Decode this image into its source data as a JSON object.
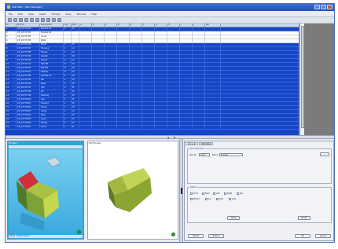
{
  "window": {
    "title": "CAD PRO - [Part Manager]",
    "controls": [
      "minimize",
      "maximize",
      "close"
    ]
  },
  "menu": [
    "File",
    "Edit",
    "View",
    "Insert",
    "Format",
    "Tools",
    "Window",
    "Help"
  ],
  "toolbar_icons": [
    "new-icon",
    "open-icon",
    "save-icon",
    "print-icon",
    "cut-icon",
    "copy-icon",
    "paste-icon",
    "undo-icon",
    "zoom-icon",
    "rotate-icon"
  ],
  "grid": {
    "columns": [
      "No",
      "Part ID",
      "Description",
      "Qty",
      "Mat",
      "A",
      "B",
      "C",
      "D",
      "E",
      "F",
      "G",
      "H",
      "I",
      "J",
      "Ref"
    ],
    "rows": [
      {
        "style": "blue",
        "cells": [
          "1",
          "UP_12371782",
          "Bracket 01",
          "1",
          "St",
          "",
          "",
          "",
          "",
          "",
          "",
          "",
          "",
          "",
          "",
          ""
        ]
      },
      {
        "style": "white",
        "cells": [
          "2",
          "UP_12371783",
          "Bracket 02",
          "",
          "",
          "",
          "",
          "",
          "",
          "",
          "",
          "",
          "",
          "",
          "",
          ""
        ]
      },
      {
        "style": "white",
        "cells": [
          "3",
          "UP_12371784",
          "Cover",
          "",
          "",
          "",
          "",
          "",
          "",
          "",
          "",
          "",
          "",
          "",
          "",
          ""
        ]
      },
      {
        "style": "white",
        "cells": [
          "4",
          "UP_12371785",
          "Plate",
          "",
          "",
          "",
          "",
          "",
          "",
          "",
          "",
          "",
          "",
          "",
          "",
          ""
        ]
      },
      {
        "style": "blue",
        "cells": [
          "5",
          "UP_12371786",
          "Shaft",
          "2",
          "St",
          "",
          "",
          "",
          "",
          "",
          "",
          "",
          "",
          "",
          "",
          ""
        ]
      },
      {
        "style": "blue",
        "cells": [
          "6",
          "UP_12371787",
          "Housing",
          "1",
          "Al",
          "",
          "",
          "",
          "",
          "",
          "",
          "",
          "",
          "",
          "",
          ""
        ]
      },
      {
        "style": "blue",
        "cells": [
          "7",
          "UP_12371788",
          "Flange",
          "1",
          "St",
          "",
          "",
          "",
          "",
          "",
          "",
          "",
          "",
          "",
          "",
          ""
        ]
      },
      {
        "style": "blue",
        "cells": [
          "8",
          "UP_12371789",
          "Gasket",
          "4",
          "Rb",
          "",
          "",
          "",
          "",
          "",
          "",
          "",
          "",
          "",
          "",
          ""
        ]
      },
      {
        "style": "blue",
        "cells": [
          "9",
          "UP_12371790",
          "Spacer",
          "2",
          "Al",
          "",
          "",
          "",
          "",
          "",
          "",
          "",
          "",
          "",
          "",
          ""
        ]
      },
      {
        "style": "blue",
        "cells": [
          "10",
          "UP_12371791",
          "Bolt M6",
          "8",
          "St",
          "",
          "",
          "",
          "",
          "",
          "",
          "",
          "",
          "",
          "",
          ""
        ]
      },
      {
        "style": "blue",
        "cells": [
          "11",
          "UP_12371792",
          "Nut M6",
          "8",
          "St",
          "",
          "",
          "",
          "",
          "",
          "",
          "",
          "",
          "",
          "",
          ""
        ]
      },
      {
        "style": "blue",
        "cells": [
          "12",
          "UP_12371793",
          "Washer",
          "8",
          "St",
          "",
          "",
          "",
          "",
          "",
          "",
          "",
          "",
          "",
          "",
          ""
        ]
      },
      {
        "style": "blue",
        "cells": [
          "13",
          "UP_12371794",
          "Bracket 03",
          "1",
          "St",
          "",
          "",
          "",
          "",
          "",
          "",
          "",
          "",
          "",
          "",
          ""
        ]
      },
      {
        "style": "blue",
        "cells": [
          "14",
          "UP_12371795",
          "Rib",
          "2",
          "St",
          "",
          "",
          "",
          "",
          "",
          "",
          "",
          "",
          "",
          "",
          ""
        ]
      },
      {
        "style": "blue",
        "cells": [
          "15",
          "UP_12371796",
          "Base",
          "1",
          "St",
          "",
          "",
          "",
          "",
          "",
          "",
          "",
          "",
          "",
          "",
          ""
        ]
      },
      {
        "style": "blue",
        "cells": [
          "16",
          "UP_12371797",
          "Clip",
          "4",
          "Pl",
          "",
          "",
          "",
          "",
          "",
          "",
          "",
          "",
          "",
          "",
          ""
        ]
      },
      {
        "style": "blue",
        "cells": [
          "17",
          "UP_12371798",
          "Pin",
          "2",
          "St",
          "",
          "",
          "",
          "",
          "",
          "",
          "",
          "",
          "",
          "",
          ""
        ]
      },
      {
        "style": "blue",
        "cells": [
          "18",
          "UP_12371799",
          "Bushing",
          "2",
          "Br",
          "",
          "",
          "",
          "",
          "",
          "",
          "",
          "",
          "",
          "",
          ""
        ]
      },
      {
        "style": "blue",
        "cells": [
          "19",
          "UP_12371800",
          "Cap",
          "1",
          "Pl",
          "",
          "",
          "",
          "",
          "",
          "",
          "",
          "",
          "",
          "",
          ""
        ]
      },
      {
        "style": "blue",
        "cells": [
          "20",
          "UP_12371801",
          "Support",
          "1",
          "St",
          "",
          "",
          "",
          "",
          "",
          "",
          "",
          "",
          "",
          "",
          ""
        ]
      },
      {
        "style": "blue",
        "cells": [
          "21",
          "UP_12371802",
          "Frame",
          "1",
          "St",
          "",
          "",
          "",
          "",
          "",
          "",
          "",
          "",
          "",
          "",
          ""
        ]
      },
      {
        "style": "blue",
        "cells": [
          "22",
          "UP_12371803",
          "Guide",
          "2",
          "Al",
          "",
          "",
          "",
          "",
          "",
          "",
          "",
          "",
          "",
          "",
          ""
        ]
      },
      {
        "style": "blue",
        "cells": [
          "23",
          "UP_12371804",
          "Stop",
          "2",
          "St",
          "",
          "",
          "",
          "",
          "",
          "",
          "",
          "",
          "",
          "",
          ""
        ]
      },
      {
        "style": "blue",
        "cells": [
          "24",
          "UP_12371805",
          "Lever",
          "1",
          "St",
          "",
          "",
          "",
          "",
          "",
          "",
          "",
          "",
          "",
          "",
          ""
        ]
      },
      {
        "style": "blue",
        "cells": [
          "25",
          "UP_12371806",
          "Spring",
          "2",
          "St",
          "",
          "",
          "",
          "",
          "",
          "",
          "",
          "",
          "",
          "",
          ""
        ]
      },
      {
        "style": "blue",
        "cells": [
          "26",
          "UP_12371807",
          "Knob",
          "1",
          "Pl",
          "",
          "",
          "",
          "",
          "",
          "",
          "",
          "",
          "",
          "",
          ""
        ]
      }
    ]
  },
  "preview_left": {
    "title": "3D View",
    "status": "Ready - Model loaded"
  },
  "preview_mid": {
    "title": "Part Preview"
  },
  "props": {
    "tabs": [
      "General",
      "Attributes"
    ],
    "group1_label": "Part information",
    "id_label": "Part ID",
    "id_value": "1234",
    "name_label": "Name",
    "name_value": "Bracket",
    "browse_label": "...",
    "group2_label": "Options",
    "options": [
      "Front",
      "Back",
      "Left",
      "Right",
      "Top",
      "Bottom",
      "Iso",
      "Side",
      "Auto"
    ],
    "apply_label": "Apply",
    "reset_label": "Reset",
    "bottom_buttons": [
      "Import",
      "Export",
      "OK",
      "Cancel"
    ]
  },
  "colors": {
    "grid_selected": "#1546c7",
    "grey_pane": "#7b7b7b",
    "viewport_left": "#2fa6d9",
    "model_green": "#9ab83a"
  }
}
